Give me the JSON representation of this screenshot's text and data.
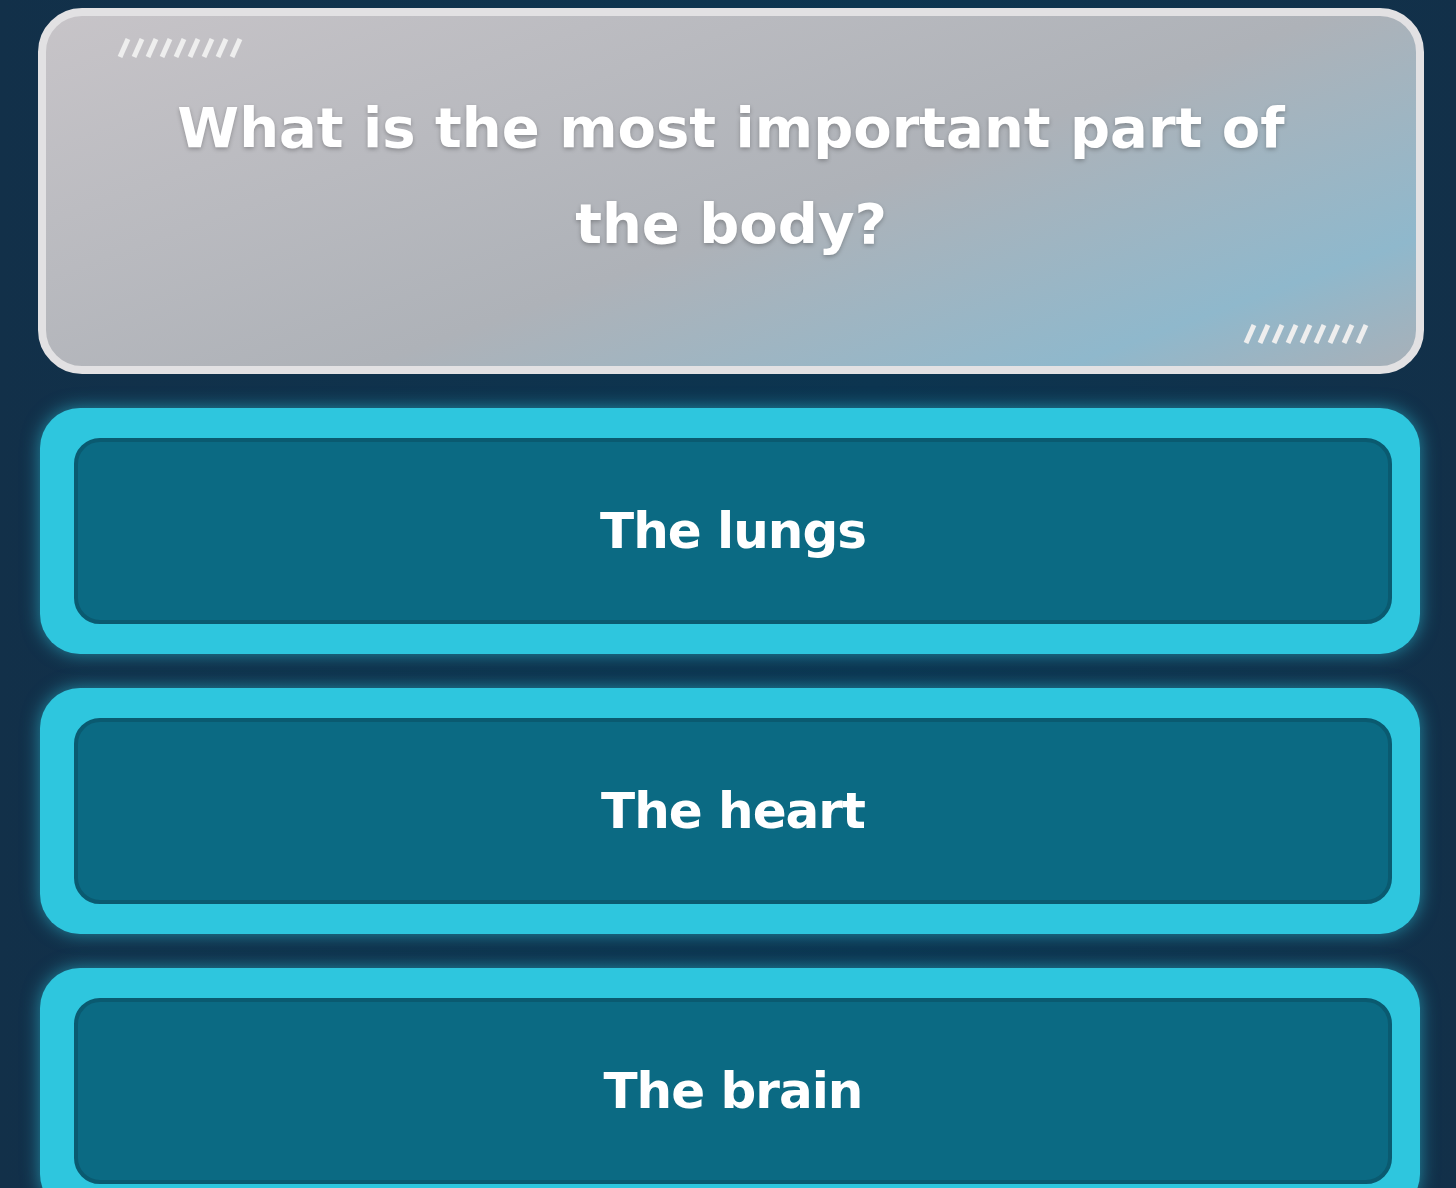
{
  "question": {
    "text": "What is the most important part of the body?"
  },
  "answers": [
    {
      "text": "The lungs"
    },
    {
      "text": "The heart"
    },
    {
      "text": "The brain"
    }
  ]
}
